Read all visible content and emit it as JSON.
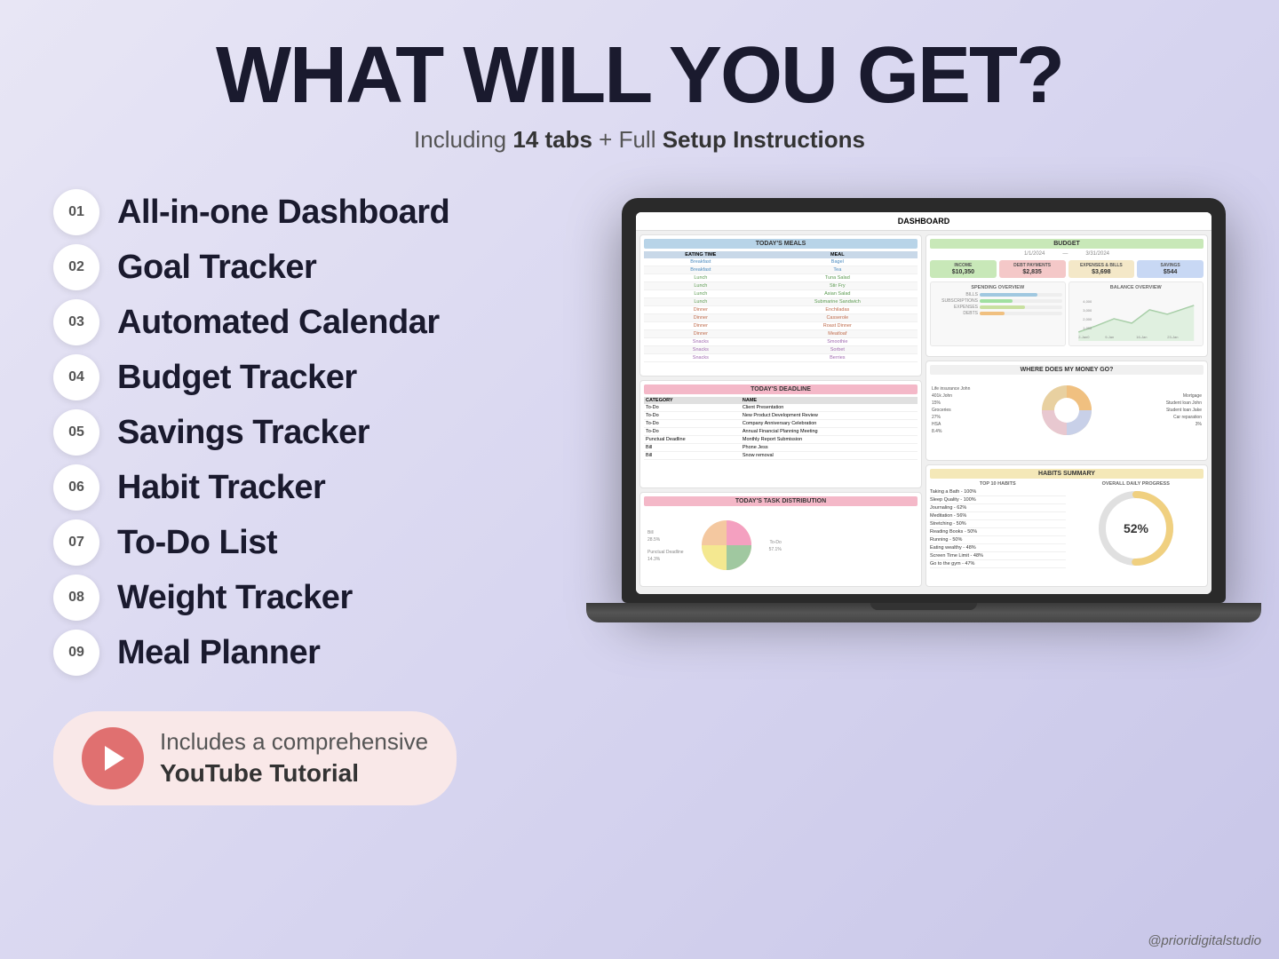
{
  "page": {
    "background": "#dcdaee"
  },
  "headline": "WHAT WILL YOU GET?",
  "subtitle": {
    "prefix": "Including ",
    "tabs": "14 tabs",
    "middle": " + Full ",
    "instructions": "Setup Instructions"
  },
  "features": [
    {
      "num": "01",
      "label": "All-in-one Dashboard"
    },
    {
      "num": "02",
      "label": "Goal Tracker"
    },
    {
      "num": "03",
      "label": "Automated Calendar"
    },
    {
      "num": "04",
      "label": "Budget Tracker"
    },
    {
      "num": "05",
      "label": "Savings Tracker"
    },
    {
      "num": "06",
      "label": "Habit Tracker"
    },
    {
      "num": "07",
      "label": "To-Do List"
    },
    {
      "num": "08",
      "label": "Weight Tracker"
    },
    {
      "num": "09",
      "label": "Meal Planner"
    }
  ],
  "youtube": {
    "line1": "Includes a comprehensive",
    "line2": "YouTube Tutorial"
  },
  "dashboard": {
    "title": "DASHBOARD",
    "meals_title": "TODAY'S MEALS",
    "budget_title": "BUDGET",
    "deadline_title": "TODAY'S DEADLINE",
    "task_title": "TODAY'S TASK DISTRIBUTION",
    "habits_title": "HABITS SUMMARY",
    "budget_period": {
      "start": "1/1/2024",
      "end": "3/31/2024"
    },
    "budget_items": [
      {
        "label": "INCOME",
        "value": "$10,350",
        "class": "b-income"
      },
      {
        "label": "DEBT PAYMENTS",
        "value": "$2,835",
        "class": "b-debt"
      },
      {
        "label": "EXPENSES & BILLS",
        "value": "$3,698",
        "class": "b-expenses"
      },
      {
        "label": "SAVINGS",
        "value": "$544",
        "class": "b-savings"
      }
    ],
    "meals": [
      {
        "time": "Breakfast",
        "meal": "Bagel",
        "row": "tr-breakfast"
      },
      {
        "time": "Breakfast",
        "meal": "Tea",
        "row": "tr-breakfast"
      },
      {
        "time": "Lunch",
        "meal": "Tuna Salad",
        "row": "tr-lunch"
      },
      {
        "time": "Lunch",
        "meal": "Stir Fry",
        "row": "tr-lunch"
      },
      {
        "time": "Lunch",
        "meal": "Asian Salad",
        "row": "tr-lunch"
      },
      {
        "time": "Lunch",
        "meal": "Submarine Sandwich",
        "row": "tr-lunch"
      },
      {
        "time": "Dinner",
        "meal": "Enchiladas",
        "row": "tr-dinner"
      },
      {
        "time": "Dinner",
        "meal": "Casserole",
        "row": "tr-dinner"
      },
      {
        "time": "Dinner",
        "meal": "Roast Dinner",
        "row": "tr-dinner"
      },
      {
        "time": "Dinner",
        "meal": "Meatloaf",
        "row": "tr-dinner"
      },
      {
        "time": "Snacks",
        "meal": "Smoothie",
        "row": "tr-snacks"
      },
      {
        "time": "Snacks",
        "meal": "Sorbet",
        "row": "tr-snacks"
      },
      {
        "time": "Snacks",
        "meal": "Berries",
        "row": "tr-snacks"
      }
    ],
    "habits_list": [
      "Taking a Bath - 100%",
      "Sleep Quality - 100%",
      "Journaling - 62%",
      "Meditation - 56%",
      "Stretching - 50%",
      "Reading Books - 50%",
      "Running - 50%",
      "Eating wealthy - 48%",
      "Screen Time Limit - 48%",
      "Go to the gym - 47%"
    ],
    "progress_percent": "52%"
  },
  "watermark": "@prioridigitalstudio"
}
